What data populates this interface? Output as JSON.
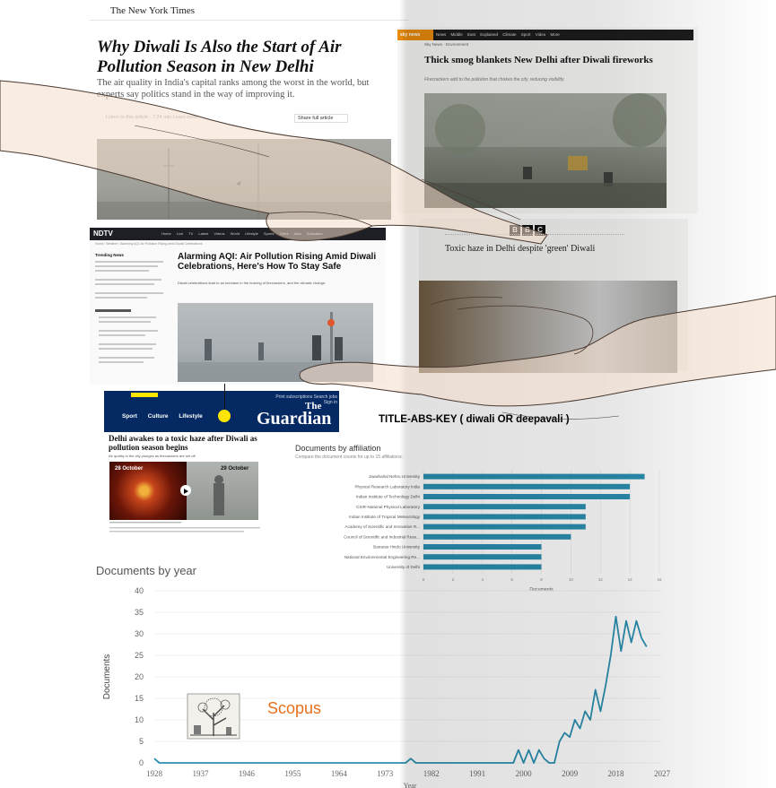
{
  "nyt": {
    "masthead": "The New York Times",
    "headline": "Why Diwali Is Also the Start of Air Pollution Season in New Delhi",
    "summary": "The air quality in India's capital ranks among the worst in the world, but experts say politics stand in the way of improving it.",
    "listen": "Listen to this article · 7:24 min  Learn more",
    "share": "Share full article"
  },
  "sky": {
    "logo": "sky news",
    "nav": "News  Middle East  Explained  Climate  Sport  Video  More",
    "kicker": "Sky News · Environment",
    "headline": "Thick smog blankets New Delhi after Diwali fireworks",
    "sub": "Firecrackers add to the pollution that chokes the city, reducing visibility."
  },
  "bbc": {
    "logo": [
      "B",
      "B",
      "C"
    ],
    "headline": "Toxic haze in Delhi despite 'green' Diwali"
  },
  "ndtv": {
    "logo": "NDTV",
    "nav": "Home  Live TV  Latest  Videos  World  Lifestyle  Sports  Cities  Auto  Education",
    "crumb": "Home / Weather / Alarming AQI: Air Pollution Rising Amid Diwali Celebrations",
    "side_heading": "Trending News",
    "headline": "Alarming AQI: Air Pollution Rising Amid Diwali Celebrations, Here's How To Stay Safe",
    "desc": "Diwali celebrations lead to an increase in the burning of firecrackers, and the climatic change."
  },
  "guardian": {
    "nav_items": [
      "Sport",
      "Culture",
      "Lifestyle"
    ],
    "support": "Print subscriptions  Search jobs  Sign in",
    "the": "The",
    "name": "Guardian",
    "headline": "Delhi awakes to a toxic haze after Diwali as pollution season begins",
    "sub": "Air quality in the city plunges as firecrackers are set off",
    "date1": "28 October",
    "date2": "29 October"
  },
  "query": "TITLE-ABS-KEY ( diwali OR deepavali )",
  "affiliation_chart": {
    "title": "Documents by affiliation",
    "subtitle": "Compare the document counts for up to 15 affiliations.",
    "xlabel": "Documents",
    "ticks": [
      0,
      2,
      4,
      6,
      8,
      10,
      12,
      14,
      16
    ],
    "color": "#2a8fb0"
  },
  "year_chart": {
    "title": "Documents by year",
    "xlabel": "Year",
    "ylabel": "Documents",
    "logo_text": "Scopus",
    "color": "#2a8fb0"
  },
  "chart_data": [
    {
      "type": "bar",
      "orientation": "horizontal",
      "title": "Documents by affiliation",
      "xlabel": "Documents",
      "xlim": [
        0,
        16
      ],
      "categories": [
        "Jawaharlal Nehru University",
        "Physical Research Laboratory India",
        "Indian Institute of Technology Delhi",
        "CSIR-National Physical Laboratory",
        "Indian Institute of Tropical Meteorology",
        "Academy of Scientific and Innovative R...",
        "Council of Scientific and Industrial Rese...",
        "Banaras Hindu University",
        "National Environmental Engineering Re...",
        "University of Delhi"
      ],
      "values": [
        15,
        14,
        14,
        11,
        11,
        11,
        10,
        8,
        8,
        8
      ]
    },
    {
      "type": "line",
      "title": "Documents by year",
      "xlabel": "Year",
      "ylabel": "Documents",
      "xlim": [
        1928,
        2027
      ],
      "ylim": [
        0,
        40
      ],
      "xticks": [
        1928,
        1937,
        1946,
        1955,
        1964,
        1973,
        1982,
        1991,
        2000,
        2009,
        2018,
        2027
      ],
      "yticks": [
        0,
        5,
        10,
        15,
        20,
        25,
        30,
        35,
        40
      ],
      "x": [
        1928,
        1929,
        1930,
        1977,
        1978,
        1979,
        1998,
        1999,
        2000,
        2001,
        2002,
        2003,
        2004,
        2005,
        2006,
        2007,
        2008,
        2009,
        2010,
        2011,
        2012,
        2013,
        2014,
        2015,
        2016,
        2017,
        2018,
        2019,
        2020,
        2021,
        2022,
        2023,
        2024
      ],
      "y": [
        1,
        0,
        0,
        0,
        1,
        0,
        0,
        3,
        0,
        3,
        0,
        3,
        1,
        0,
        0,
        5,
        7,
        6,
        10,
        8,
        12,
        10,
        17,
        12,
        18,
        25,
        34,
        26,
        33,
        28,
        33,
        29,
        27
      ]
    }
  ]
}
